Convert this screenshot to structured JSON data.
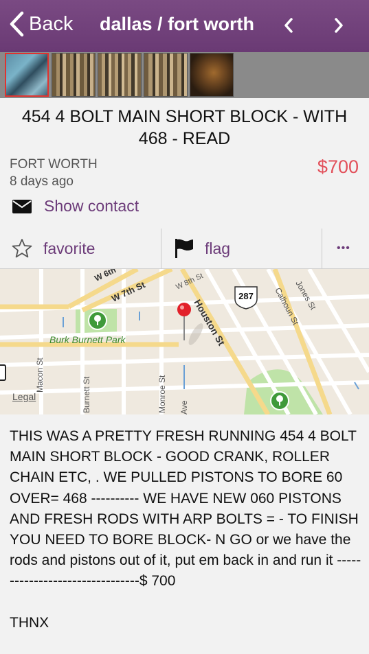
{
  "nav": {
    "back_label": "Back",
    "title": "dallas / fort worth"
  },
  "thumbnails": [
    {
      "alt": "photo 1",
      "selected": true
    },
    {
      "alt": "photo 2",
      "selected": false
    },
    {
      "alt": "photo 3",
      "selected": false
    },
    {
      "alt": "photo 4",
      "selected": false
    },
    {
      "alt": "photo 5",
      "selected": false
    }
  ],
  "post": {
    "title": "454  4 BOLT  MAIN  SHORT BLOCK - WITH 468 - READ",
    "location": "FORT WORTH",
    "age": "8 days ago",
    "price": "$700",
    "contact_label": "Show contact"
  },
  "actions": {
    "favorite_label": "favorite",
    "flag_label": "flag",
    "more_label": "•••"
  },
  "map": {
    "streets": [
      "W 6th",
      "W 7th St",
      "W 8th St",
      "Houston St",
      "Calhoun St",
      "Jones St",
      "Macon St",
      "Burnett St",
      "Monroe St",
      "Ave"
    ],
    "park_label": "Burk Burnett Park",
    "route_shield": "287",
    "legal_label": "Legal",
    "accent_pin": "#e2202a",
    "park_color": "#bfe3a8"
  },
  "description": "THIS WAS A PRETTY FRESH RUNNING 454 4 BOLT MAIN SHORT BLOCK - GOOD CRANK, ROLLER CHAIN ETC, . WE PULLED PISTONS TO BORE 60 OVER= 468 ---------- WE HAVE NEW 060 PISTONS AND FRESH RODS WITH ARP BOLTS = - TO FINISH YOU NEED TO BORE BLOCK- N GO or we have the rods and pistons out of it, put em back in and run it --------------------------------$ 700\n\nTHNX",
  "colors": {
    "nav_bg": "#7a4a83",
    "accent_purple": "#6c3b79",
    "price_red": "#e2505a"
  }
}
